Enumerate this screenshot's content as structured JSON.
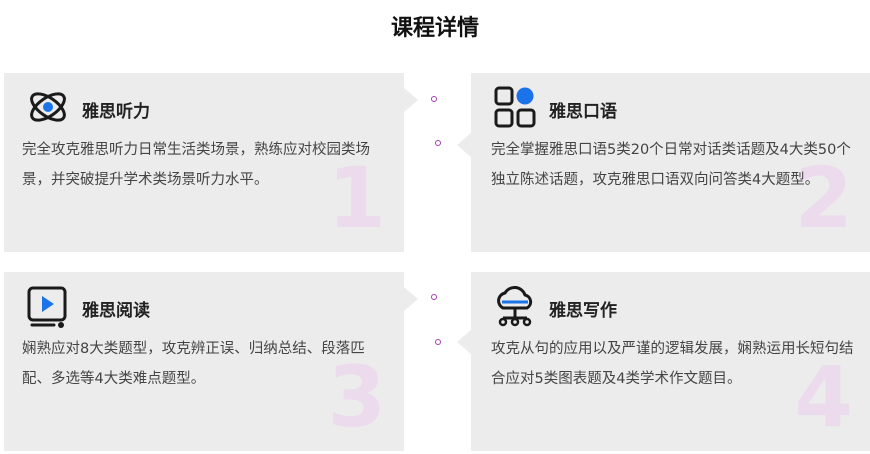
{
  "title": "课程详情",
  "colors": {
    "icon": "#1a1a1a",
    "accent": "#1a73e8",
    "dot": "#a43fb0",
    "card": "#ececec",
    "number": "#ecdbec"
  },
  "cards": [
    {
      "num": "1",
      "heading": "雅思听力",
      "icon": "atom-icon",
      "desc": "完全攻克雅思听力日常生活类场景，熟练应对校园类场景，并突破提升学术类场景听力水平。"
    },
    {
      "num": "2",
      "heading": "雅思口语",
      "icon": "grid-apps-icon",
      "desc": "完全掌握雅思口语5类20个日常对话类话题及4大类50个独立陈述话题，攻克雅思口语双向问答类4大题型。"
    },
    {
      "num": "3",
      "heading": "雅思阅读",
      "icon": "video-play-icon",
      "desc": "娴熟应对8大类题型，攻克辨正误、归纳总结、段落匹配、多选等4大类难点题型。"
    },
    {
      "num": "4",
      "heading": "雅思写作",
      "icon": "cloud-network-icon",
      "desc": "攻克从句的应用以及严谨的逻辑发展，娴熟运用长短句结合应对5类图表题及4类学术作文题目。"
    }
  ]
}
